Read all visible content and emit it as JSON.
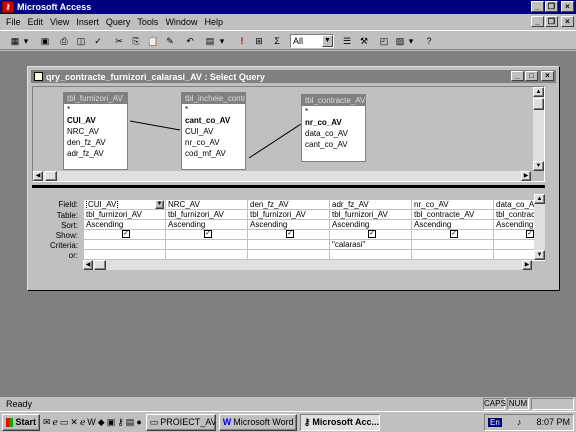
{
  "app": {
    "title": "Microsoft Access"
  },
  "menu": [
    "File",
    "Edit",
    "View",
    "Insert",
    "Query",
    "Tools",
    "Window",
    "Help"
  ],
  "toolbar": {
    "combo_value": "All"
  },
  "query_window": {
    "title": "qry_contracte_furnizori_calarasi_AV : Select Query"
  },
  "tables": [
    {
      "name": "tbl_furnizori_AV",
      "fields": [
        "*",
        "CUI_AV",
        "NRC_AV",
        "den_fz_AV",
        "adr_fz_AV"
      ]
    },
    {
      "name": "tbl_incheie_contr",
      "fields": [
        "*",
        "cant_co_AV",
        "CUI_AV",
        "nr_co_AV",
        "cod_mf_AV"
      ]
    },
    {
      "name": "tbl_contracte_AV",
      "fields": [
        "*",
        "nr_co_AV",
        "data_co_AV",
        "cant_co_AV"
      ]
    }
  ],
  "grid": {
    "row_labels": [
      "Field:",
      "Table:",
      "Sort:",
      "Show:",
      "Criteria:",
      "or:"
    ],
    "columns": [
      {
        "field": "CUI_AV",
        "table": "tbl_furnizori_AV",
        "sort": "Ascending",
        "show": true,
        "criteria": ""
      },
      {
        "field": "NRC_AV",
        "table": "tbl_furnizori_AV",
        "sort": "Ascending",
        "show": true,
        "criteria": ""
      },
      {
        "field": "den_fz_AV",
        "table": "tbl_furnizori_AV",
        "sort": "Ascending",
        "show": true,
        "criteria": ""
      },
      {
        "field": "adr_fz_AV",
        "table": "tbl_furnizori_AV",
        "sort": "Ascending",
        "show": true,
        "criteria": "\"calarasi\""
      },
      {
        "field": "nr_co_AV",
        "table": "tbl_contracte_AV",
        "sort": "Ascending",
        "show": true,
        "criteria": ""
      },
      {
        "field": "data_co_AV",
        "table": "tbl_contracte",
        "sort": "Ascending",
        "show": true,
        "criteria": ""
      }
    ]
  },
  "status": {
    "text": "Ready",
    "caps": "CAPS",
    "num": "NUM"
  },
  "taskbar": {
    "start": "Start",
    "tasks": [
      "PROIECT_AV",
      "Microsoft Word ...",
      "Microsoft Acc..."
    ],
    "lang": "En",
    "time": "8:07 PM"
  }
}
